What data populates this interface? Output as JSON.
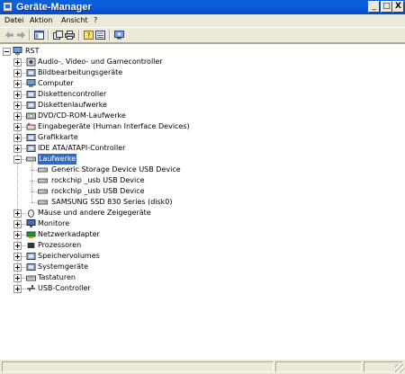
{
  "window": {
    "title": "Geräte-Manager",
    "min_label": "_",
    "max_label": "□",
    "close_label": "X"
  },
  "menu": [
    "Datei",
    "Aktion",
    "Ansicht",
    "?"
  ],
  "toolbar": [
    "back-icon",
    "forward-icon",
    "properties-icon",
    "print-icon",
    "help-icon",
    "refresh-icon",
    "scan-hardware-icon"
  ],
  "tree": {
    "root": "RST",
    "categories": [
      "Audio-, Video- und Gamecontroller",
      "Bildbearbeitungsgeräte",
      "Computer",
      "Diskettencontroller",
      "Diskettenlaufwerke",
      "DVD/CD-ROM-Laufwerke",
      "Eingabegeräte (Human Interface Devices)",
      "Grafikkarte",
      "IDE ATA/ATAPI-Controller",
      "Laufwerke",
      "Mäuse und andere Zeigegeräte",
      "Monitore",
      "Netzwerkadapter",
      "Prozessoren",
      "Speichervolumes",
      "Systemgeräte",
      "Tastaturen",
      "USB-Controller"
    ],
    "expanded_index": 9,
    "devices": [
      "Generic Storage Device USB Device",
      "rockchip _usb USB Device",
      "rockchip _usb USB Device",
      "SAMSUNG SSD 830 Series (disk0)"
    ]
  },
  "colors": {
    "titlebar": "#0a5fd8",
    "selection": "#316ac5",
    "window_face": "#ece9d8"
  }
}
